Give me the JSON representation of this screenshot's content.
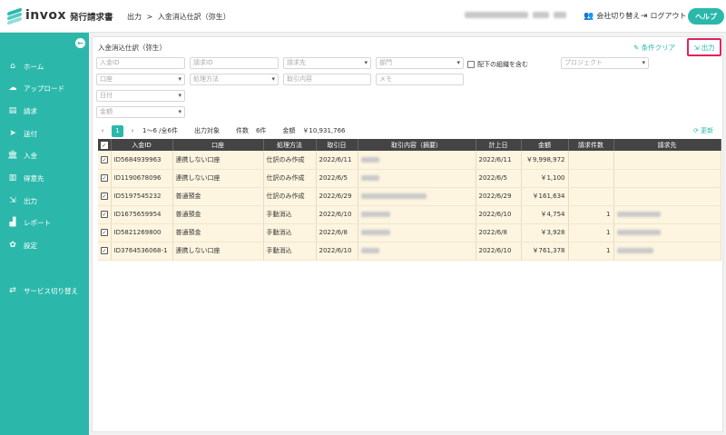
{
  "header": {
    "logo_text": "invox",
    "logo_sub": "発行請求書",
    "breadcrumb": [
      "出力",
      ">",
      "入金消込仕訳（弥生）"
    ],
    "switch_company": "会社切り替え",
    "logout": "ログアウト",
    "help": "ヘルプ",
    "icons": {
      "switch": "users-icon",
      "logout": "logout-icon"
    }
  },
  "sidebar": {
    "collapse_icon": "arrow-left-icon",
    "items": [
      {
        "label": "ホーム",
        "icon": "home-icon"
      },
      {
        "label": "アップロード",
        "icon": "cloud-upload-icon"
      },
      {
        "label": "請求",
        "icon": "document-icon"
      },
      {
        "label": "送付",
        "icon": "send-icon"
      },
      {
        "label": "入金",
        "icon": "bank-icon"
      },
      {
        "label": "得意先",
        "icon": "building-icon"
      },
      {
        "label": "出力",
        "icon": "export-icon"
      },
      {
        "label": "レポート",
        "icon": "chart-icon"
      },
      {
        "label": "設定",
        "icon": "gear-icon"
      }
    ],
    "service_switch": "サービス切り替え"
  },
  "main": {
    "title": "入金消込仕訳（弥生）",
    "clear_label": "条件クリア",
    "export_label": "出力",
    "filters": {
      "payment_id": "入金ID",
      "invoice_id": "請求ID",
      "billing_to": "請求先",
      "department": "部門",
      "include_sub": "配下の組織を含む",
      "project": "プロジェクト",
      "account": "口座",
      "method": "処理方法",
      "transaction": "取引内容",
      "memo": "メモ",
      "date": "日付",
      "amount": "金額"
    },
    "pager": {
      "page": "1",
      "range": "1〜6 /全6件",
      "target_label": "出力対象",
      "count_label": "件数",
      "count": "6件",
      "amount_label": "金額",
      "amount": "￥10,931,766",
      "refresh": "更新"
    },
    "columns": [
      "入金ID",
      "口座",
      "処理方法",
      "取引日",
      "取引内容（摘要）",
      "計上日",
      "金額",
      "請求件数",
      "請求先"
    ],
    "rows": [
      {
        "id": "ID5684939963",
        "account": "連携しない口座",
        "method": "仕訳のみ作成",
        "date": "2022/6/11",
        "post": "2022/6/11",
        "amount": "￥9,998,972",
        "count": ""
      },
      {
        "id": "ID1190678096",
        "account": "連携しない口座",
        "method": "仕訳のみ作成",
        "date": "2022/6/5",
        "post": "2022/6/5",
        "amount": "￥1,100",
        "count": ""
      },
      {
        "id": "ID5197545232",
        "account": "普通預金",
        "method": "仕訳のみ作成",
        "date": "2022/6/29",
        "post": "2022/6/29",
        "amount": "￥161,634",
        "count": ""
      },
      {
        "id": "ID1675659954",
        "account": "普通預金",
        "method": "手動消込",
        "date": "2022/6/10",
        "post": "2022/6/10",
        "amount": "￥4,754",
        "count": "1"
      },
      {
        "id": "ID5821269800",
        "account": "普通預金",
        "method": "手動消込",
        "date": "2022/6/8",
        "post": "2022/6/8",
        "amount": "￥3,928",
        "count": "1"
      },
      {
        "id": "ID3764536068-1",
        "account": "連携しない口座",
        "method": "手動消込",
        "date": "2022/6/10",
        "post": "2022/6/10",
        "amount": "￥761,378",
        "count": "1"
      }
    ]
  },
  "colors": {
    "accent": "#2bb8ab",
    "header_dark": "#444444",
    "row_bg": "#fdf5e0",
    "highlight": "#e0245e"
  }
}
